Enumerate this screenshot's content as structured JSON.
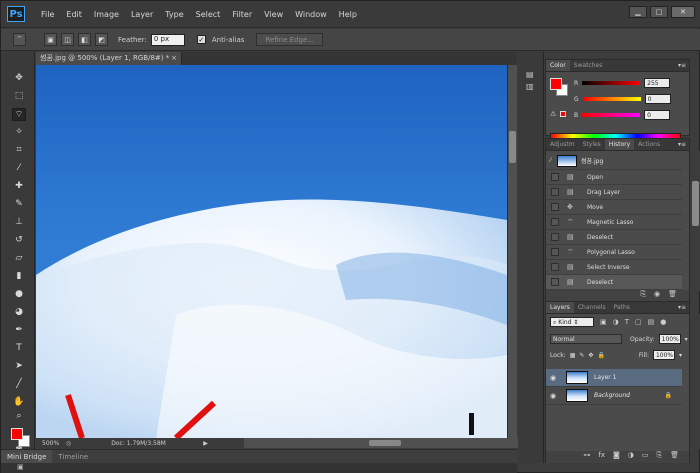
{
  "app": {
    "logo": "Ps",
    "menu": [
      "File",
      "Edit",
      "Image",
      "Layer",
      "Type",
      "Select",
      "Filter",
      "View",
      "Window",
      "Help"
    ],
    "window_buttons": [
      "▁",
      "□",
      "✕"
    ]
  },
  "options_bar": {
    "feather_label": "Feather:",
    "feather_value": "0 px",
    "antialias_label": "Anti-alias",
    "refine_edge_label": "Refine Edge..."
  },
  "document": {
    "tab_title": "썸꿈.jpg @ 500% (Layer 1, RGB/8#) *",
    "zoom": "500%",
    "doc_size": "Doc: 1.79M/3.58M"
  },
  "bottom_tabs": [
    "Mini Bridge",
    "Timeline"
  ],
  "color_panel": {
    "tabs": [
      "Color",
      "Swatches"
    ],
    "channels": [
      {
        "label": "R",
        "value": "255"
      },
      {
        "label": "G",
        "value": "0"
      },
      {
        "label": "B",
        "value": "0"
      }
    ],
    "foreground": "#ff0000",
    "background": "#ffffff"
  },
  "history_panel": {
    "tabs": [
      "Adjustm",
      "Styles",
      "History",
      "Actions"
    ],
    "snapshot": "썸꿈.jpg",
    "items": [
      "Open",
      "Drag Layer",
      "Move",
      "Magnetic Lasso",
      "Deselect",
      "Polygonal Lasso",
      "Select Inverse",
      "Deselect"
    ]
  },
  "layers_panel": {
    "tabs": [
      "Layers",
      "Channels",
      "Paths"
    ],
    "filter_kind": "Kind",
    "blend_mode": "Normal",
    "opacity_label": "Opacity:",
    "opacity_value": "100%",
    "lock_label": "Lock:",
    "fill_label": "Fill:",
    "fill_value": "100%",
    "layers": [
      {
        "name": "Layer 1",
        "selected": true
      },
      {
        "name": "Background",
        "selected": false,
        "locked": true
      }
    ]
  }
}
